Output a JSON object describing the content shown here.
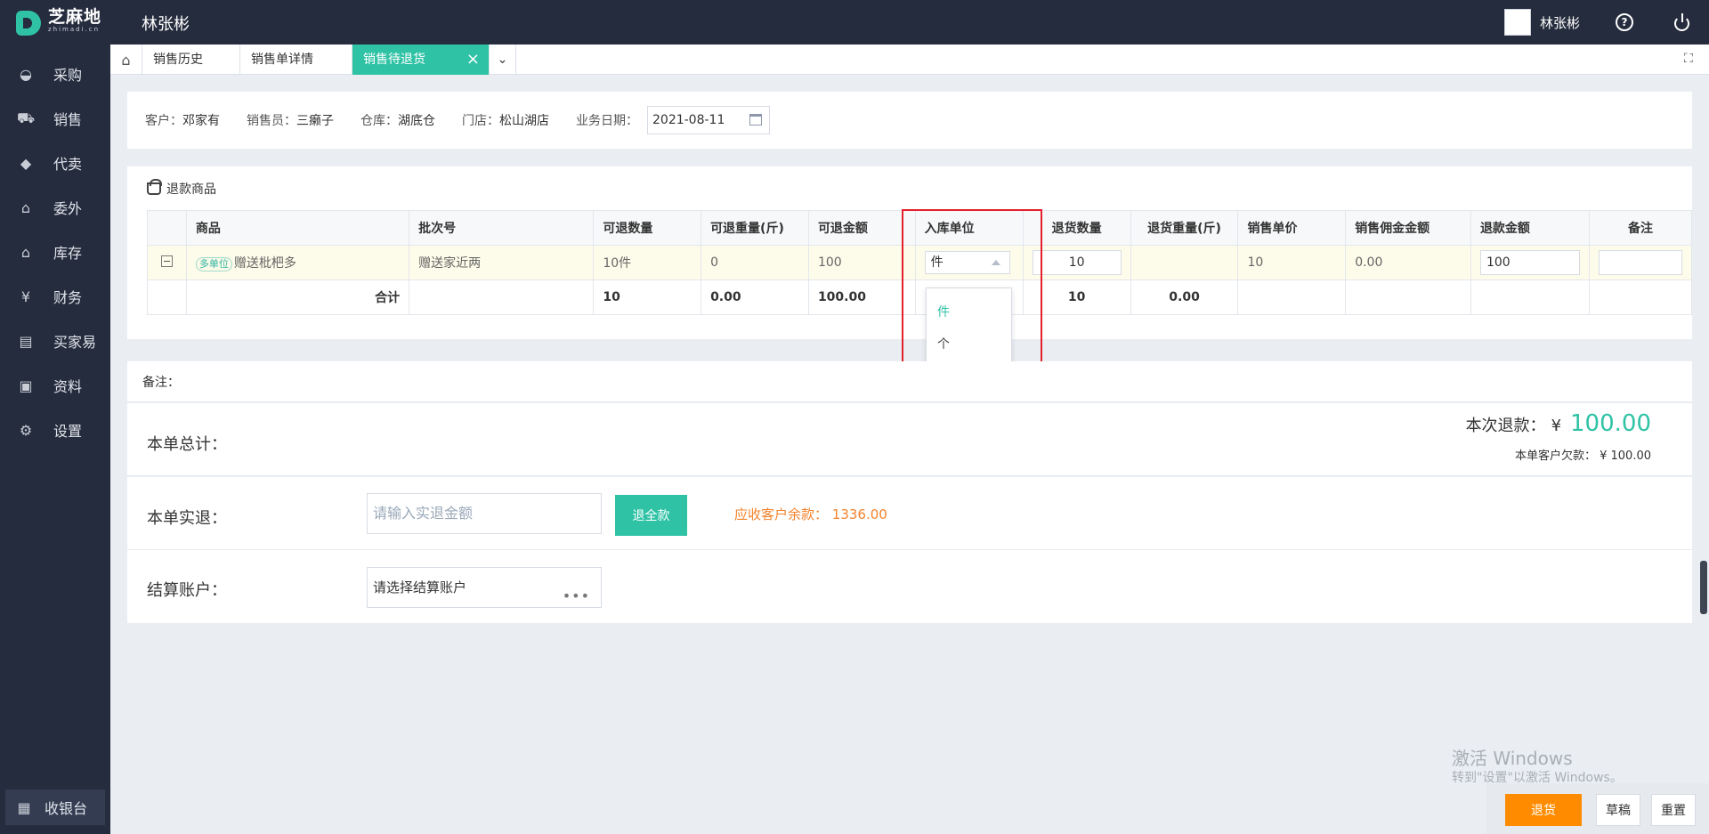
{
  "app": {
    "logo_zh": "芝麻地",
    "logo_en": "zhimadi.cn",
    "title": "林张彬"
  },
  "topbar": {
    "username": "林张彬",
    "help_glyph": "?"
  },
  "sidebar": {
    "items": [
      {
        "label": "采购",
        "icon": "basket-icon"
      },
      {
        "label": "销售",
        "icon": "cart-icon"
      },
      {
        "label": "代卖",
        "icon": "tag-icon"
      },
      {
        "label": "委外",
        "icon": "warehouse-icon"
      },
      {
        "label": "库存",
        "icon": "store-icon"
      },
      {
        "label": "财务",
        "icon": "money-icon"
      },
      {
        "label": "买家易",
        "icon": "shop-icon"
      },
      {
        "label": "资料",
        "icon": "printer-icon"
      },
      {
        "label": "设置",
        "icon": "gear-icon"
      }
    ],
    "cashier": "收银台"
  },
  "tabs": [
    {
      "label": "销售历史"
    },
    {
      "label": "销售单详情"
    },
    {
      "label": "销售待退货",
      "active": true
    }
  ],
  "info": {
    "customer_label": "客户：",
    "customer": "邓家有",
    "salesman_label": "销售员：",
    "salesman": "三癞子",
    "warehouse_label": "仓库：",
    "warehouse": "湖底仓",
    "store_label": "门店：",
    "store": "松山湖店",
    "date_label": "业务日期：",
    "date": "2021-08-11"
  },
  "goods": {
    "title": "退款商品",
    "columns": [
      "商品",
      "批次号",
      "可退数量",
      "可退重量(斤)",
      "可退金额",
      "入库单位",
      "退货数量",
      "退货重量(斤)",
      "销售单价",
      "销售佣金金额",
      "退款金额",
      "备注"
    ],
    "row": {
      "tag": "多单位",
      "name": "赠送枇杷多",
      "batch": "赠送家近两",
      "returnable_qty": "10件",
      "returnable_weight": "0",
      "returnable_amount": "100",
      "unit": "件",
      "return_qty": "10",
      "return_weight": "",
      "unit_price": "10",
      "commission": "0.00",
      "refund_amount": "100",
      "remark": ""
    },
    "total": {
      "label": "合计",
      "returnable_qty": "10",
      "returnable_weight": "0.00",
      "returnable_amount": "100.00",
      "return_qty": "10",
      "return_weight": "0.00"
    },
    "unit_options": [
      "件",
      "个"
    ]
  },
  "remark_label": "备注：",
  "summary": {
    "label": "本单总计：",
    "refund_label": "本次退款：",
    "currency": "¥",
    "refund_amount": "100.00",
    "owe_text": "本单客户欠款：  ¥ 100.00"
  },
  "actual": {
    "label": "本单实退：",
    "placeholder": "请输入实退金额",
    "full_button": "退全款",
    "due_label": "应收客户余款：",
    "due_amount": "1336.00"
  },
  "account": {
    "label": "结算账户：",
    "placeholder": "请选择结算账户",
    "more": "•••"
  },
  "watermark": {
    "line1": "激活 Windows",
    "line2": "转到\"设置\"以激活 Windows。"
  },
  "actions": {
    "return": "退货",
    "draft": "草稿",
    "reset": "重置"
  },
  "colors": {
    "accent": "#2fc2a5",
    "sidebar": "#252c3d",
    "primary_button": "#ff8c00",
    "due_text": "#f4832c",
    "highlight_box": "#e3202b"
  }
}
